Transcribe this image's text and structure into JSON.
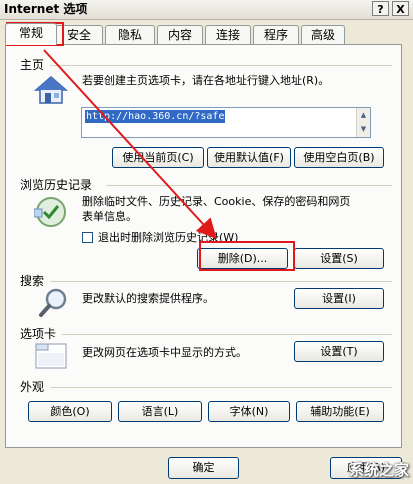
{
  "window": {
    "title": "Internet 选项",
    "help_label": "?",
    "close_label": "X"
  },
  "tabs": [
    {
      "label": "常规"
    },
    {
      "label": "安全"
    },
    {
      "label": "隐私"
    },
    {
      "label": "内容"
    },
    {
      "label": "连接"
    },
    {
      "label": "程序"
    },
    {
      "label": "高级"
    }
  ],
  "home": {
    "section_title": "主页",
    "description": "若要创建主页选项卡，请在各地址行键入地址(R)。",
    "url_value": "http://hao.360.cn/?safe",
    "use_current_label": "使用当前页(C)",
    "use_default_label": "使用默认值(F)",
    "use_blank_label": "使用空白页(B)"
  },
  "history": {
    "section_title": "浏览历史记录",
    "description_line1": "删除临时文件、历史记录、Cookie、保存的密码和网页",
    "description_line2": "表单信息。",
    "checkbox_label": "退出时删除浏览历史记录(W)",
    "delete_label": "删除(D)...",
    "settings_label": "设置(S)"
  },
  "search": {
    "section_title": "搜索",
    "description": "更改默认的搜索提供程序。",
    "settings_label": "设置(I)"
  },
  "tabs_section": {
    "section_title": "选项卡",
    "description": "更改网页在选项卡中显示的方式。",
    "settings_label": "设置(T)"
  },
  "appearance": {
    "section_title": "外观",
    "colors_label": "颜色(O)",
    "languages_label": "语言(L)",
    "fonts_label": "字体(N)",
    "accessibility_label": "辅助功能(E)"
  },
  "footer": {
    "ok_label": "确定",
    "apply_label": "应用(A)"
  },
  "watermark": "系统之家",
  "colors": {
    "annotation_red": "#e0191a",
    "url_selection": "#316ac5",
    "button_border": "#003c74"
  }
}
